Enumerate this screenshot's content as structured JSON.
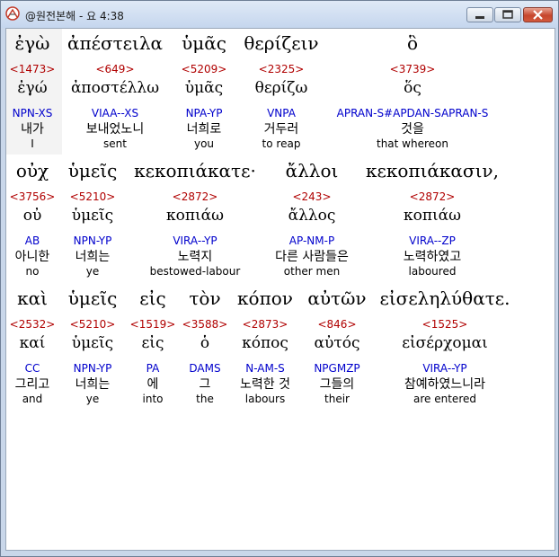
{
  "window": {
    "title": "@원전본해 - 요 4:38"
  },
  "rows": [
    {
      "tokens": [
        {
          "greek": "ἐγὼ",
          "strong": "<1473>",
          "lemma": "ἐγώ",
          "morph": "NPN-XS",
          "korean": "내가",
          "english": "I"
        },
        {
          "greek": "ἀπέστειλα",
          "strong": "<649>",
          "lemma": "ἀποστέλλω",
          "morph": "VIAA--XS",
          "korean": "보내었노니",
          "english": "sent"
        },
        {
          "greek": "ὑμᾶς",
          "strong": "<5209>",
          "lemma": "ὑμᾶς",
          "morph": "NPA-YP",
          "korean": "너희로",
          "english": "you"
        },
        {
          "greek": "θερίζειν",
          "strong": "<2325>",
          "lemma": "θερίζω",
          "morph": "VNPA",
          "korean": "거두러",
          "english": "to reap"
        },
        {
          "greek": "ὃ",
          "strong": "<3739>",
          "lemma": "ὅς",
          "morph": "APRAN-S#APDAN-SAPRAN-S",
          "korean": "것을",
          "english": "that whereon"
        }
      ]
    },
    {
      "tokens": [
        {
          "greek": "οὐχ",
          "strong": "<3756>",
          "lemma": "οὐ",
          "morph": "AB",
          "korean": "아니한",
          "english": "no"
        },
        {
          "greek": "ὑμεῖς",
          "strong": "<5210>",
          "lemma": "ὑμεῖς",
          "morph": "NPN-YP",
          "korean": "너희는",
          "english": "ye"
        },
        {
          "greek": "κεκοπιάκατε·",
          "strong": "<2872>",
          "lemma": "κοπιάω",
          "morph": "VIRA--YP",
          "korean": "노력지",
          "english": "bestowed-labour"
        },
        {
          "greek": "ἄλλοι",
          "strong": "<243>",
          "lemma": "ἄλλος",
          "morph": "AP-NM-P",
          "korean": "다른 사람들은",
          "english": "other men"
        },
        {
          "greek": "κεκοπιάκασιν,",
          "strong": "<2872>",
          "lemma": "κοπιάω",
          "morph": "VIRA--ZP",
          "korean": "노력하였고",
          "english": "laboured"
        }
      ]
    },
    {
      "tokens": [
        {
          "greek": "καὶ",
          "strong": "<2532>",
          "lemma": "καί",
          "morph": "CC",
          "korean": "그리고",
          "english": "and"
        },
        {
          "greek": "ὑμεῖς",
          "strong": "<5210>",
          "lemma": "ὑμεῖς",
          "morph": "NPN-YP",
          "korean": "너희는",
          "english": "ye"
        },
        {
          "greek": "εἰς",
          "strong": "<1519>",
          "lemma": "εἰς",
          "morph": "PA",
          "korean": "에",
          "english": "into"
        },
        {
          "greek": "τὸν",
          "strong": "<3588>",
          "lemma": "ὁ",
          "morph": "DAMS",
          "korean": "그",
          "english": "the"
        },
        {
          "greek": "κόπον",
          "strong": "<2873>",
          "lemma": "κόπος",
          "morph": "N-AM-S",
          "korean": "노력한 것",
          "english": "labours"
        },
        {
          "greek": "αὐτῶν",
          "strong": "<846>",
          "lemma": "αὐτός",
          "morph": "NPGMZP",
          "korean": "그들의",
          "english": "their"
        },
        {
          "greek": "εἰσεληλύθατε.",
          "strong": "<1525>",
          "lemma": "εἰσέρχομαι",
          "morph": "VIRA--YP",
          "korean": "참예하였느니라",
          "english": "are entered"
        }
      ]
    }
  ]
}
